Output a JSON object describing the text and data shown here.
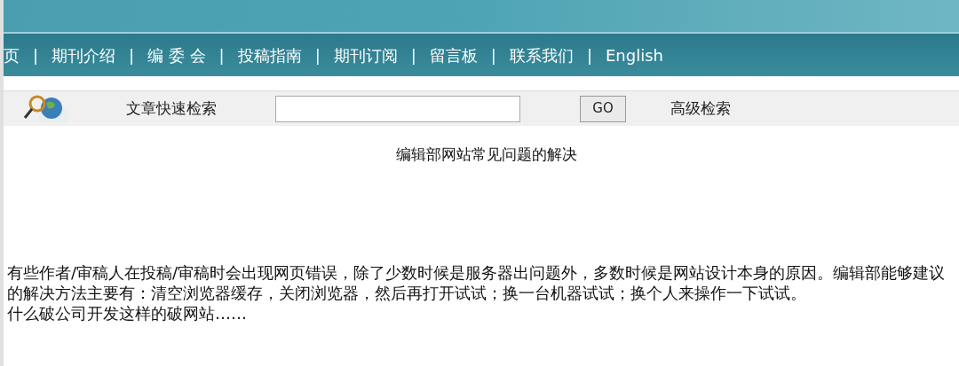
{
  "nav": {
    "items": [
      {
        "label": "页"
      },
      {
        "label": "期刊介绍"
      },
      {
        "label": "编 委 会"
      },
      {
        "label": "投稿指南"
      },
      {
        "label": "期刊订阅"
      },
      {
        "label": "留言板"
      },
      {
        "label": "联系我们"
      },
      {
        "label": "English"
      }
    ],
    "separator": "|"
  },
  "search": {
    "label": "文章快速检索",
    "button": "GO",
    "advanced": "高级检索"
  },
  "article": {
    "title": "编辑部网站常见问题的解决",
    "paragraphs": [
      "有些作者/审稿人在投稿/审稿时会出现网页错误，除了少数时候是服务器出问题外，多数时候是网站设计本身的原因。编辑部能够建议的解决方法主要有：清空浏览器缓存，关闭浏览器，然后再打开试试；换一台机器试试；换个人来操作一下试试。",
      "什么破公司开发这样的破网站……"
    ]
  }
}
